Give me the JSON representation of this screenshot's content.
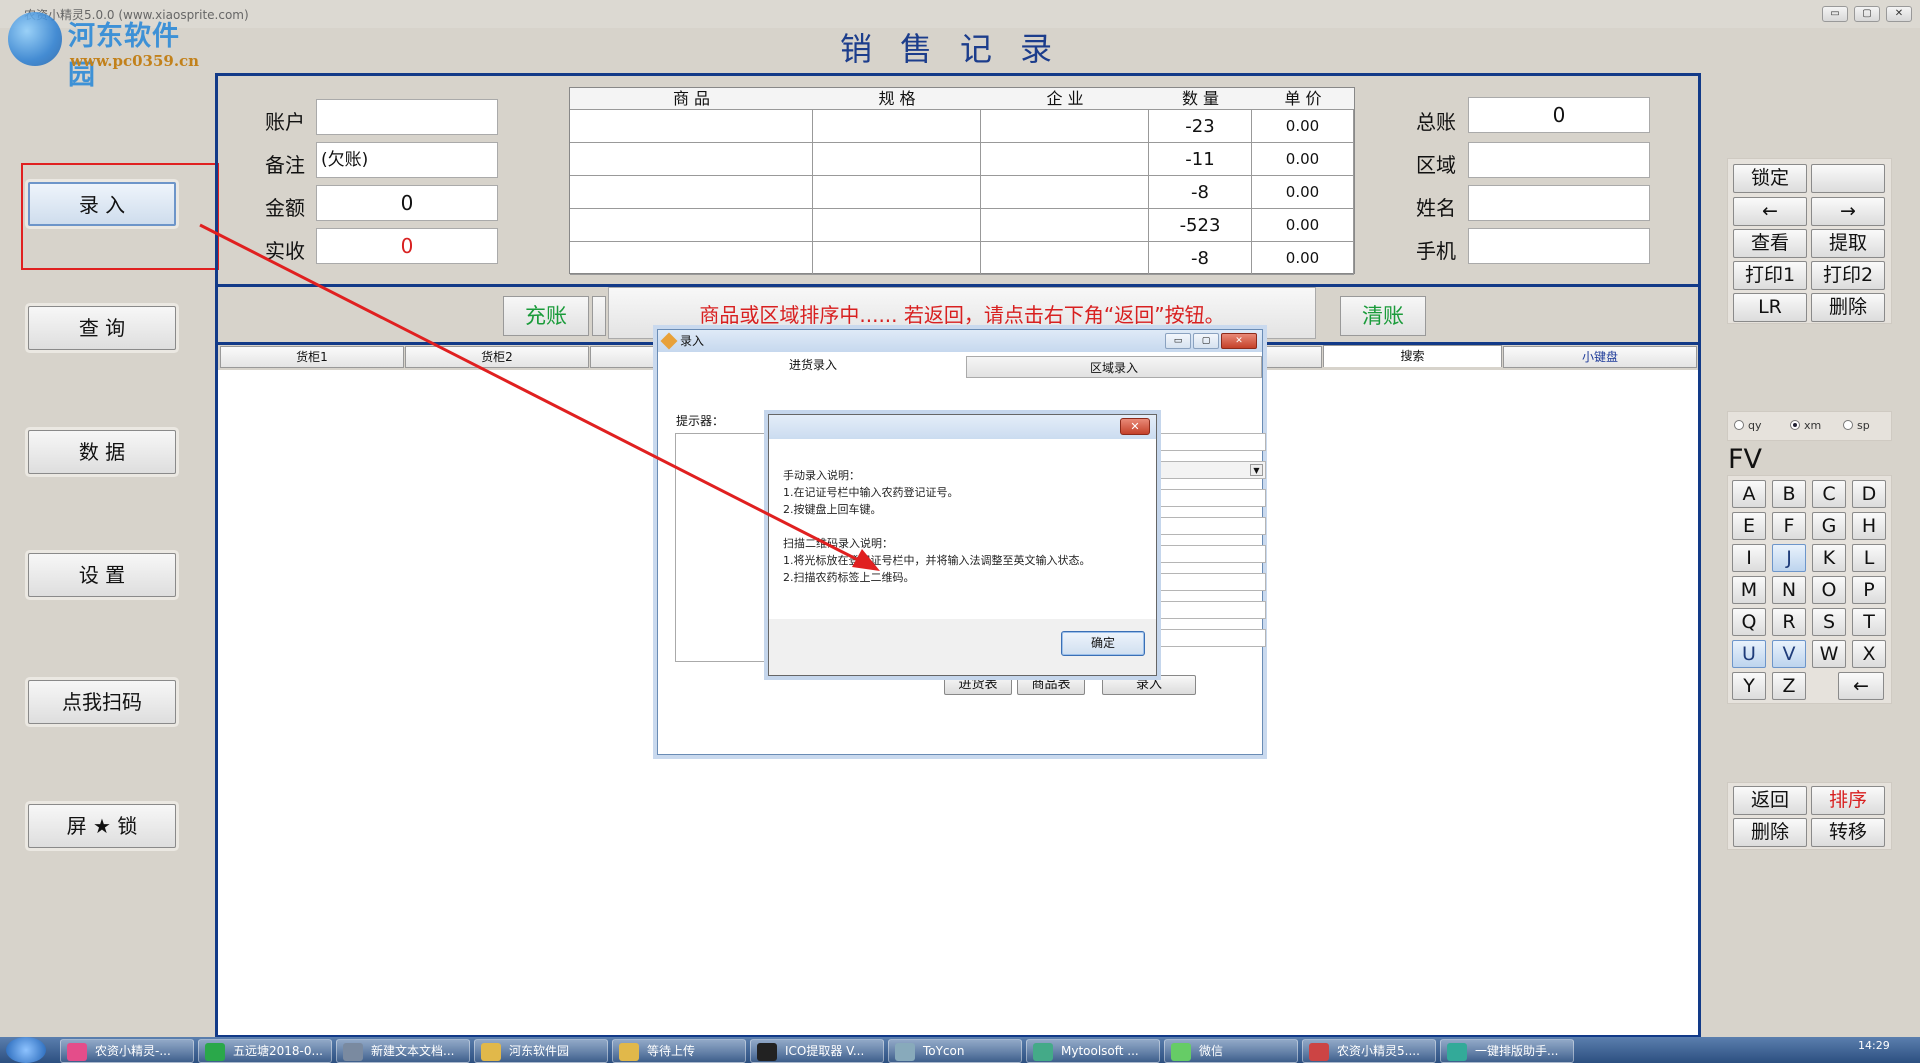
{
  "window": {
    "title": "农资小精灵5.0.0    (www.xiaosprite.com)",
    "min_label": "▭",
    "max_label": "▢",
    "close_label": "✕"
  },
  "watermark": {
    "title": "河东软件园",
    "url": "www.pc0359.cn"
  },
  "page_title": "销售记录",
  "left_nav": [
    "录  入",
    "查  询",
    "数  据",
    "设  置",
    "点我扫码",
    "屏 ★ 锁"
  ],
  "form_left": {
    "labels": [
      "账户",
      "备注",
      "金额",
      "实收"
    ],
    "values": [
      "",
      "(欠账)",
      "0",
      "0"
    ]
  },
  "goods_table": {
    "headers": [
      "商  品",
      "规  格",
      "企  业",
      "数  量",
      "单  价"
    ],
    "rows": [
      {
        "product": "",
        "spec": "",
        "company": "",
        "qty": "-23",
        "price": "0.00"
      },
      {
        "product": "",
        "spec": "",
        "company": "",
        "qty": "-11",
        "price": "0.00"
      },
      {
        "product": "",
        "spec": "",
        "company": "",
        "qty": "-8",
        "price": "0.00"
      },
      {
        "product": "",
        "spec": "",
        "company": "",
        "qty": "-523",
        "price": "0.00"
      },
      {
        "product": "",
        "spec": "",
        "company": "",
        "qty": "-8",
        "price": "0.00"
      }
    ]
  },
  "form_right": {
    "labels": [
      "总账",
      "区域",
      "姓名",
      "手机"
    ],
    "values": [
      "0",
      "",
      "",
      ""
    ]
  },
  "actions": {
    "recharge": "充账",
    "clear": "清账",
    "banner": "商品或区域排序中...... 若返回，请点击右下角“返回”按钮。"
  },
  "shelf_tabs": [
    "货柜1",
    "货柜2",
    "搜索",
    "小键盘"
  ],
  "right_top_buttons": [
    "锁定",
    "",
    "←",
    "→",
    "查看",
    "提取",
    "打印1",
    "打印2",
    "LR",
    "删除"
  ],
  "radios": [
    {
      "label": "qy",
      "checked": false
    },
    {
      "label": "xm",
      "checked": true
    },
    {
      "label": "sp",
      "checked": false
    }
  ],
  "keyboard_label": "FV",
  "keys": [
    "A",
    "B",
    "C",
    "D",
    "E",
    "F",
    "G",
    "H",
    "I",
    "J",
    "K",
    "L",
    "M",
    "N",
    "O",
    "P",
    "Q",
    "R",
    "S",
    "T",
    "U",
    "V",
    "W",
    "X",
    "Y",
    "Z",
    "←"
  ],
  "bottom_right_buttons": [
    "返回",
    "排序",
    "删除",
    "转移"
  ],
  "entry_dialog": {
    "title": "录入",
    "tabs": [
      "进货录入",
      "区域录入"
    ],
    "hint_label": "提示器：",
    "buttons": [
      "进货表",
      "商品表",
      "录入"
    ]
  },
  "message_box": {
    "lines": [
      "手动录入说明：",
      "1.在记证号栏中输入农药登记证号。",
      "2.按键盘上回车键。",
      "",
      "扫描二维码录入说明：",
      "1.将光标放在登记证号栏中，并将输入法调整至英文输入状态。",
      "2.扫描农药标签上二维码。"
    ],
    "ok": "确定"
  },
  "taskbar": {
    "items": [
      "农资小精灵-...",
      "五远塘2018-0...",
      "新建文本文档...",
      "河东软件园",
      "等待上传",
      "ICO提取器 V...",
      "ToYcon",
      "Mytoolsoft ...",
      "微信",
      "农资小精灵5....",
      "一键排版助手..."
    ],
    "clock": "14:29"
  },
  "colors": {
    "frame": "#123a88",
    "title": "#1c3d8c",
    "green": "#1a9b3a",
    "red": "#d82020",
    "annotation": "#e02020"
  }
}
